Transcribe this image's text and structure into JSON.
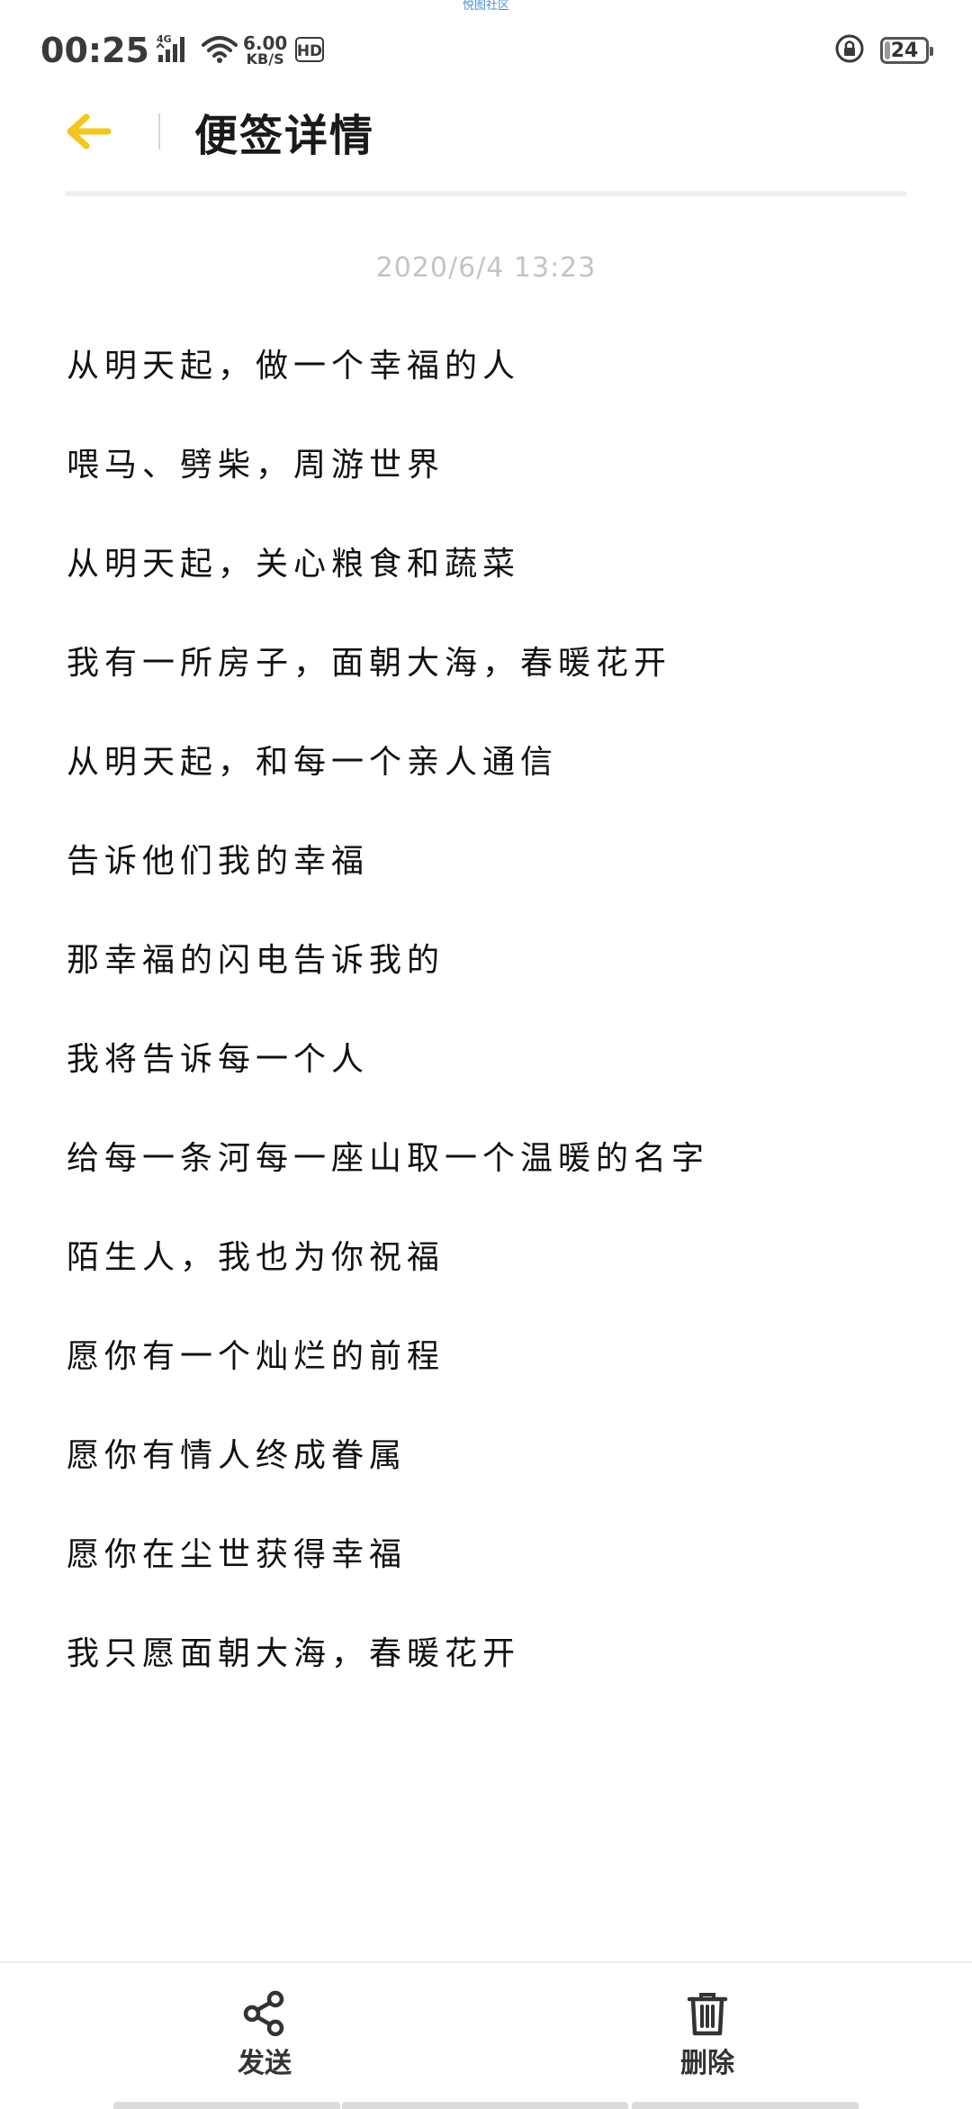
{
  "watermark": "悦图社区",
  "status_bar": {
    "time": "00:25",
    "network_type": "4G",
    "net_speed_value": "6.00",
    "net_speed_unit": "KB/S",
    "hd_badge": "HD",
    "battery_level": "24"
  },
  "header": {
    "title": "便签详情",
    "back_icon": "arrow-left-icon",
    "accent_color": "#f5c518"
  },
  "note": {
    "date": "2020/6/4 13:23",
    "lines": [
      "从明天起，做一个幸福的人",
      "喂马、劈柴，周游世界",
      "从明天起，关心粮食和蔬菜",
      "我有一所房子，面朝大海，春暖花开",
      "从明天起，和每一个亲人通信",
      "告诉他们我的幸福",
      "那幸福的闪电告诉我的",
      "我将告诉每一个人",
      "给每一条河每一座山取一个温暖的名字",
      "陌生人，我也为你祝福",
      "愿你有一个灿烂的前程",
      "愿你有情人终成眷属",
      "愿你在尘世获得幸福",
      "我只愿面朝大海，春暖花开"
    ]
  },
  "actions": {
    "share_label": "发送",
    "share_icon": "share-icon",
    "delete_label": "删除",
    "delete_icon": "trash-icon"
  }
}
